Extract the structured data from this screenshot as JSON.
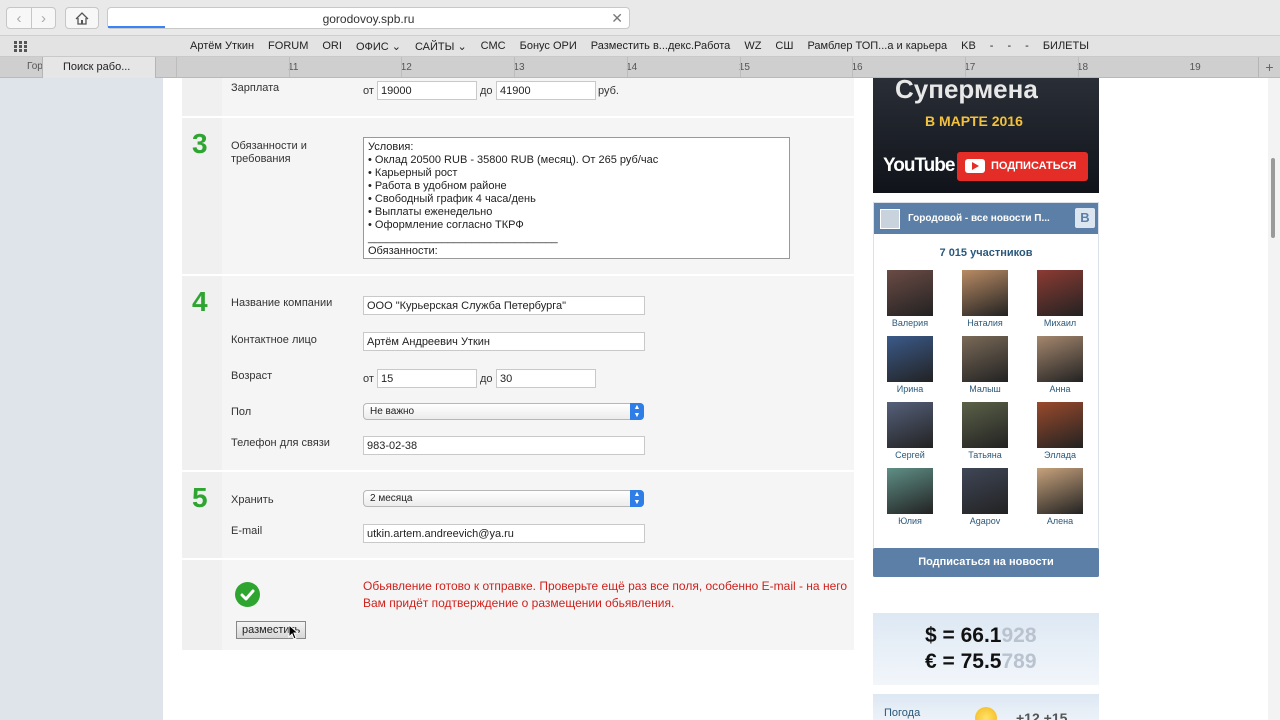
{
  "browser": {
    "url": "gorodovoy.spb.ru",
    "load_progress": 0.11,
    "bookmarks": [
      "Артём Уткин",
      "FORUM",
      "ORI",
      "ОФИС ⌄",
      "САЙТЫ ⌄",
      "СМС",
      "Бонус ОРИ",
      "Разместить в...декс.Работа",
      "WZ",
      "СШ",
      "Рамблер ТОП...а и карьера",
      "KB",
      "-",
      "-",
      "-",
      "БИЛЕТЫ"
    ],
    "tab_stub": "Горо",
    "active_tab": "Поиск рабо...",
    "tab_ticks": [
      "11",
      "12",
      "13",
      "14",
      "15",
      "16",
      "17",
      "18",
      "19"
    ],
    "new_tab": "+"
  },
  "form": {
    "salary": {
      "label": "Зарплата",
      "from_label": "от",
      "from": "19000",
      "to_label": "до",
      "to": "41900",
      "unit": "руб."
    },
    "section3": {
      "number": "3",
      "label": "Обязанности и требования",
      "text_lines": [
        "Условия:",
        "• Оклад 20500 RUB - 35800 RUB (месяц). От 265 руб/час",
        "• Карьерный рост",
        "• Работа в удобном районе",
        "• Свободный график 4 часа/день",
        "• Выплаты еженедельно",
        "• Оформление согласно ТКРФ",
        "_______________________________",
        "Обязанности:"
      ]
    },
    "section4": {
      "number": "4",
      "company_label": "Название компании",
      "company": "ООО \"Курьерская Служба Петербурга\"",
      "contact_label": "Контактное лицо",
      "contact": "Артём Андреевич Уткин",
      "age_label": "Возраст",
      "age_from_label": "от",
      "age_from": "15",
      "age_to_label": "до",
      "age_to": "30",
      "gender_label": "Пол",
      "gender": "Не важно",
      "phone_label": "Телефон для связи",
      "phone": "983-02-38"
    },
    "section5": {
      "number": "5",
      "store_label": "Хранить",
      "store": "2 месяца",
      "email_label": "E-mail",
      "email": "utkin.artem.andreevich@ya.ru"
    },
    "notice": "Обьявление готово к отправке. Проверьте ещё раз все поля, особенно E-mail - на него Вам придёт подтверждение о размещении обьявления.",
    "submit": "разместить"
  },
  "sidebar": {
    "banner_title": "Супермена",
    "banner_date": "В МАРТЕ 2016",
    "youtube_logo": "YouTube",
    "subscribe": "ПОДПИСАТЬСЯ",
    "vk": {
      "group": "Городовой - все новости П...",
      "badge": "В",
      "count": "7 015 участников",
      "members": [
        {
          "name": "Валерия",
          "color": "#6b4b45"
        },
        {
          "name": "Наталия",
          "color": "#b98b64"
        },
        {
          "name": "Михаил",
          "color": "#8c3b33"
        },
        {
          "name": "Ирина",
          "color": "#3b5a8a"
        },
        {
          "name": "Малыш",
          "color": "#7a6a58"
        },
        {
          "name": "Анна",
          "color": "#a5876e"
        },
        {
          "name": "Сергей",
          "color": "#55607a"
        },
        {
          "name": "Татьяна",
          "color": "#5b6148"
        },
        {
          "name": "Эллада",
          "color": "#9a4a2c"
        },
        {
          "name": "Юлия",
          "color": "#5f8f86"
        },
        {
          "name": "Agapov",
          "color": "#3f4656"
        },
        {
          "name": "Алена",
          "color": "#c7a27c"
        }
      ],
      "subscribe_news": "Подписаться на новости"
    },
    "rates": {
      "usd_prefix": "$ = 66.1",
      "usd_fade": "928",
      "eur_prefix": "€ = 75.5",
      "eur_fade": "789"
    },
    "weather": {
      "label": "Погода",
      "temp": "+12 +15"
    }
  }
}
